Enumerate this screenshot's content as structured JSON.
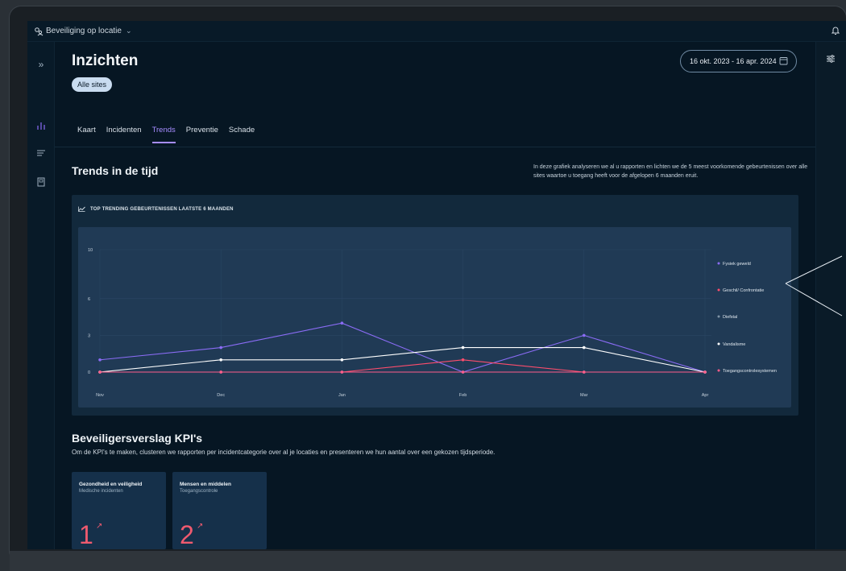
{
  "topbar": {
    "site_label": "Beveiliging op locatie"
  },
  "page": {
    "title": "Inzichten",
    "chip": "Alle sites",
    "date_range": "16 okt. 2023 - 16 apr. 2024"
  },
  "tabs": [
    {
      "label": "Kaart"
    },
    {
      "label": "Incidenten"
    },
    {
      "label": "Trends",
      "active": true
    },
    {
      "label": "Preventie"
    },
    {
      "label": "Schade"
    }
  ],
  "trends": {
    "title": "Trends in de tijd",
    "description": "In deze grafiek analyseren we al u rapporten en lichten we de 5 meest voorkomende gebeurtenissen over alle sites waartoe u toegang heeft voor de afgelopen 6 maanden eruit.",
    "chart_header": "TOP TRENDING GEBEURTENISSEN LAATSTE 6 MAANDEN"
  },
  "chart_data": {
    "type": "line",
    "categories": [
      "Nov",
      "Dec",
      "Jan",
      "Feb",
      "Mar",
      "Apr"
    ],
    "y_ticks": [
      "0",
      "3",
      "6",
      "10"
    ],
    "y_tick_values": [
      0,
      3,
      6,
      10
    ],
    "ylim": [
      0,
      10
    ],
    "grid": true,
    "legend_position": "right",
    "series": [
      {
        "name": "Fysiek geweld",
        "color": "#8b6cf6",
        "values": [
          1,
          2,
          4,
          0,
          3,
          0
        ]
      },
      {
        "name": "Geschil/ Confrontatie",
        "color": "#ff4d6d",
        "values": [
          0,
          0,
          0,
          1,
          0,
          0
        ]
      },
      {
        "name": "Diefstal",
        "color": "#7f93a6",
        "values": [
          0,
          0,
          0,
          0,
          0,
          0
        ]
      },
      {
        "name": "Vandalisme",
        "color": "#ffffff",
        "values": [
          0,
          1,
          1,
          2,
          2,
          0
        ]
      },
      {
        "name": "Toegangscontrolesystemen",
        "color": "#ff5c8a",
        "values": [
          0,
          0,
          0,
          0,
          0,
          0
        ]
      }
    ]
  },
  "kpi": {
    "title": "Beveiligersverslag KPI's",
    "subtitle": "Om de KPI's te maken, clusteren we rapporten per incidentcategorie over al je locaties en presenteren we hun aantal over een gekozen tijdsperiode.",
    "cards": [
      {
        "title": "Gezondheid en veiligheid",
        "subtitle": "Medische incidenten",
        "value": "1"
      },
      {
        "title": "Mensen en middelen",
        "subtitle": "Toegangscontrole",
        "value": "2"
      }
    ]
  },
  "colors": {
    "accent": "#a68cff",
    "kpi_value": "#ef5a6f",
    "background": "#061623"
  }
}
